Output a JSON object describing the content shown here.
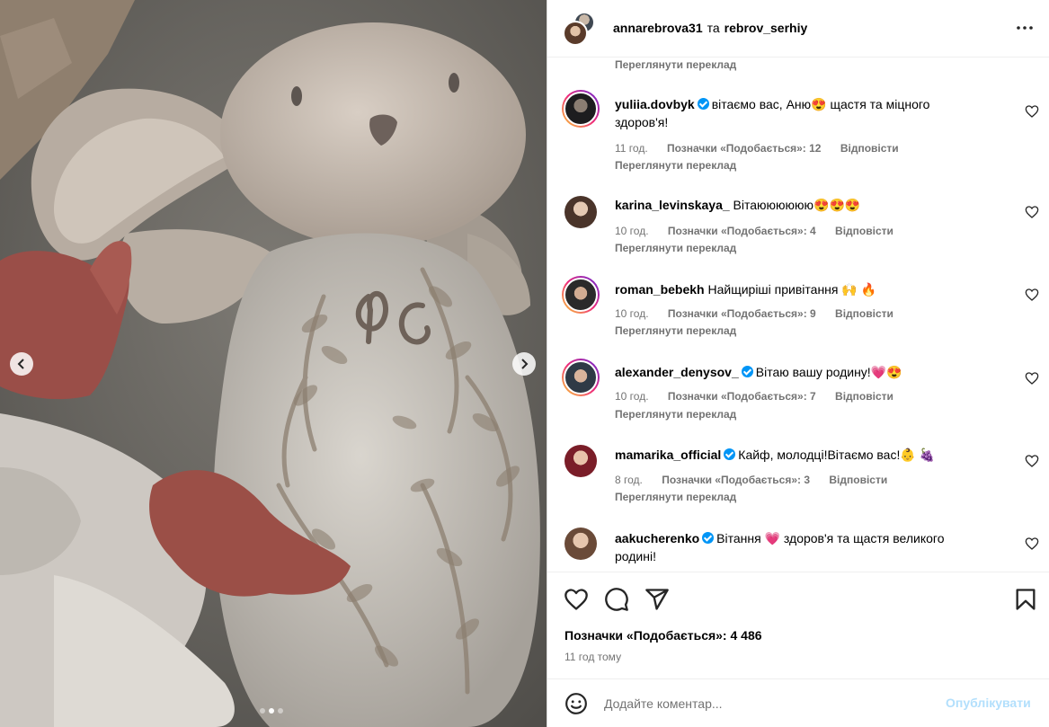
{
  "header": {
    "user1": "annarebrova31",
    "separator": "та",
    "user2": "rebrov_serhiy"
  },
  "top_translate": "Переглянути переклад",
  "comments": [
    {
      "username": "yuliia.dovbyk",
      "verified": true,
      "text_line1": "вітаємо вас, Аню😍 щастя та міцного",
      "text_line2": "здоров'я!",
      "time": "11 год.",
      "likes": "Позначки «Подобається»: 12",
      "reply": "Відповісти",
      "translate": "Переглянути переклад"
    },
    {
      "username": "karina_levinskaya_",
      "verified": false,
      "text_line1": "Вітаюююююю😍😍😍",
      "time": "10 год.",
      "likes": "Позначки «Подобається»: 4",
      "reply": "Відповісти",
      "translate": "Переглянути переклад"
    },
    {
      "username": "roman_bebekh",
      "verified": false,
      "text_line1": "Найщиріші привітання 🙌 🔥",
      "time": "10 год.",
      "likes": "Позначки «Подобається»: 9",
      "reply": "Відповісти",
      "translate": "Переглянути переклад"
    },
    {
      "username": "alexander_denysov_",
      "verified": true,
      "text_line1": "Вітаю вашу родину!💗😍",
      "time": "10 год.",
      "likes": "Позначки «Подобається»: 7",
      "reply": "Відповісти",
      "translate": "Переглянути переклад"
    },
    {
      "username": "mamarika_official",
      "verified": true,
      "text_line1": "Кайф, молодці!Вітаємо вас!👶 🍇",
      "time": "8 год.",
      "likes": "Позначки «Подобається»: 3",
      "reply": "Відповісти",
      "translate": "Переглянути переклад"
    },
    {
      "username": "aakucherenko",
      "verified": true,
      "text_line1": "Вітання 💗 здоров'я та щастя великого",
      "text_line2": "родині!"
    }
  ],
  "actions": {
    "like_icon": "heart-icon",
    "comment_icon": "comment-icon",
    "share_icon": "share-icon",
    "save_icon": "bookmark-icon"
  },
  "likes_total": "Позначки «Подобається»: 4 486",
  "time_ago": "11 год тому",
  "add_comment": {
    "placeholder": "Додайте коментар...",
    "post_label": "Опублікувати"
  },
  "carousel": {
    "slides": 3,
    "active": 2
  },
  "colors": {
    "accent": "#0095f6",
    "post_disabled": "#b2dffc",
    "muted": "#737373"
  }
}
